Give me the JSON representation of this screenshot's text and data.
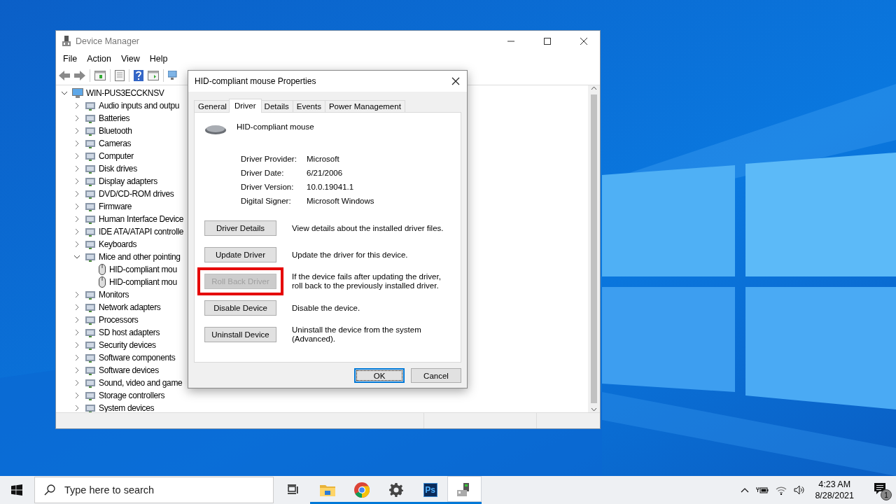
{
  "device_manager": {
    "title": "Device Manager",
    "menu": [
      "File",
      "Action",
      "View",
      "Help"
    ],
    "tree": {
      "label": "WIN-PUS3ECCKNSV",
      "expanded": true,
      "children": [
        {
          "label": "Audio inputs and outpu",
          "expanded": false
        },
        {
          "label": "Batteries",
          "expanded": false
        },
        {
          "label": "Bluetooth",
          "expanded": false
        },
        {
          "label": "Cameras",
          "expanded": false
        },
        {
          "label": "Computer",
          "expanded": false
        },
        {
          "label": "Disk drives",
          "expanded": false
        },
        {
          "label": "Display adapters",
          "expanded": false
        },
        {
          "label": "DVD/CD-ROM drives",
          "expanded": false
        },
        {
          "label": "Firmware",
          "expanded": false
        },
        {
          "label": "Human Interface Device",
          "expanded": false
        },
        {
          "label": "IDE ATA/ATAPI controlle",
          "expanded": false
        },
        {
          "label": "Keyboards",
          "expanded": false
        },
        {
          "label": "Mice and other pointing",
          "expanded": true,
          "children": [
            {
              "label": "HID-compliant mou"
            },
            {
              "label": "HID-compliant mou"
            }
          ]
        },
        {
          "label": "Monitors",
          "expanded": false
        },
        {
          "label": "Network adapters",
          "expanded": false
        },
        {
          "label": "Processors",
          "expanded": false
        },
        {
          "label": "SD host adapters",
          "expanded": false
        },
        {
          "label": "Security devices",
          "expanded": false
        },
        {
          "label": "Software components",
          "expanded": false
        },
        {
          "label": "Software devices",
          "expanded": false
        },
        {
          "label": "Sound, video and game",
          "expanded": false
        },
        {
          "label": "Storage controllers",
          "expanded": false
        },
        {
          "label": "System devices",
          "expanded": false
        }
      ]
    }
  },
  "dialog": {
    "title": "HID-compliant mouse Properties",
    "tabs": [
      {
        "label": "General",
        "selected": false
      },
      {
        "label": "Driver",
        "selected": true
      },
      {
        "label": "Details",
        "selected": false
      },
      {
        "label": "Events",
        "selected": false
      },
      {
        "label": "Power Management",
        "selected": false
      }
    ],
    "device_name": "HID-compliant mouse",
    "properties": [
      {
        "label": "Driver Provider:",
        "value": "Microsoft"
      },
      {
        "label": "Driver Date:",
        "value": "6/21/2006"
      },
      {
        "label": "Driver Version:",
        "value": "10.0.19041.1"
      },
      {
        "label": "Digital Signer:",
        "value": "Microsoft Windows"
      }
    ],
    "actions": [
      {
        "button": "Driver Details",
        "description": "View details about the installed driver files.",
        "disabled": false,
        "highlighted": false
      },
      {
        "button": "Update Driver",
        "description": "Update the driver for this device.",
        "disabled": false,
        "highlighted": false
      },
      {
        "button": "Roll Back Driver",
        "description": "If the device fails after updating the driver, roll back to the previously installed driver.",
        "disabled": true,
        "highlighted": true
      },
      {
        "button": "Disable Device",
        "description": "Disable the device.",
        "disabled": false,
        "highlighted": false
      },
      {
        "button": "Uninstall Device",
        "description": "Uninstall the device from the system (Advanced).",
        "disabled": false,
        "highlighted": false
      }
    ],
    "buttons": [
      {
        "label": "OK",
        "focused": true
      },
      {
        "label": "Cancel",
        "focused": false
      }
    ]
  },
  "taskbar": {
    "search": {
      "placeholder": "Type here to search"
    },
    "apps": [
      {
        "kind": "folder",
        "running": true,
        "active": false
      },
      {
        "kind": "browser",
        "running": true,
        "active": false
      },
      {
        "kind": "settings",
        "running": true,
        "active": false
      },
      {
        "kind": "photoshop",
        "label": "Ps",
        "running": true,
        "active": false
      },
      {
        "kind": "device-manager",
        "running": true,
        "active": true
      }
    ],
    "clock": {
      "time": "4:23 AM",
      "date": "8/28/2021"
    },
    "notifications": {
      "count": "1"
    }
  }
}
